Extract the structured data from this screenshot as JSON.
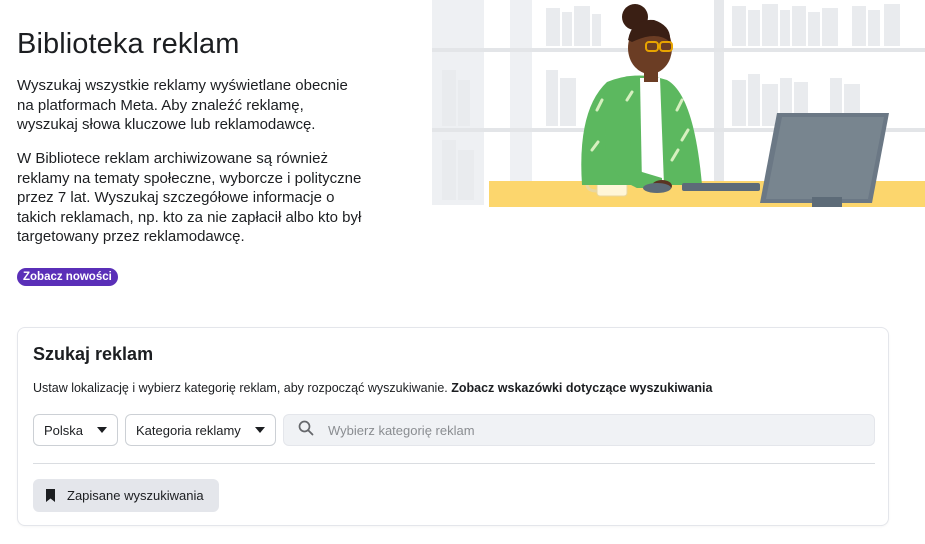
{
  "hero": {
    "title": "Biblioteka reklam",
    "paragraph1": "Wyszukaj wszystkie reklamy wyświetlane obecnie na platformach Meta. Aby znaleźć reklamę, wyszukaj słowa kluczowe lub reklamodawcę.",
    "paragraph2": "W Bibliotece reklam archiwizowane są również reklamy na tematy społeczne, wyborcze i polityczne przez 7 lat. Wyszukaj szczegółowe informacje o takich reklamach, np. kto za nie zapłacił albo kto był targetowany przez reklamodawcę.",
    "badge": "Zobacz nowości",
    "illustration_icon": "person-at-computer-illustration"
  },
  "search_card": {
    "title": "Szukaj reklam",
    "description": "Ustaw lokalizację i wybierz kategorię reklam, aby rozpocząć wyszukiwanie.",
    "tips_link": "Zobacz wskazówki dotyczące wyszukiwania",
    "country_dropdown": {
      "value": "Polska",
      "icon": "caret-down-icon"
    },
    "category_dropdown": {
      "value": "Kategoria reklamy",
      "icon": "caret-down-icon"
    },
    "search": {
      "placeholder": "Wybierz kategorię reklam",
      "icon": "search-icon"
    },
    "saved_searches": {
      "label": "Zapisane wyszukiwania",
      "icon": "bookmark-icon"
    }
  },
  "colors": {
    "badge": "#5a2fb8",
    "desk": "#fcd66d",
    "sweater": "#5cb85f",
    "monitor": "#6b7885"
  }
}
